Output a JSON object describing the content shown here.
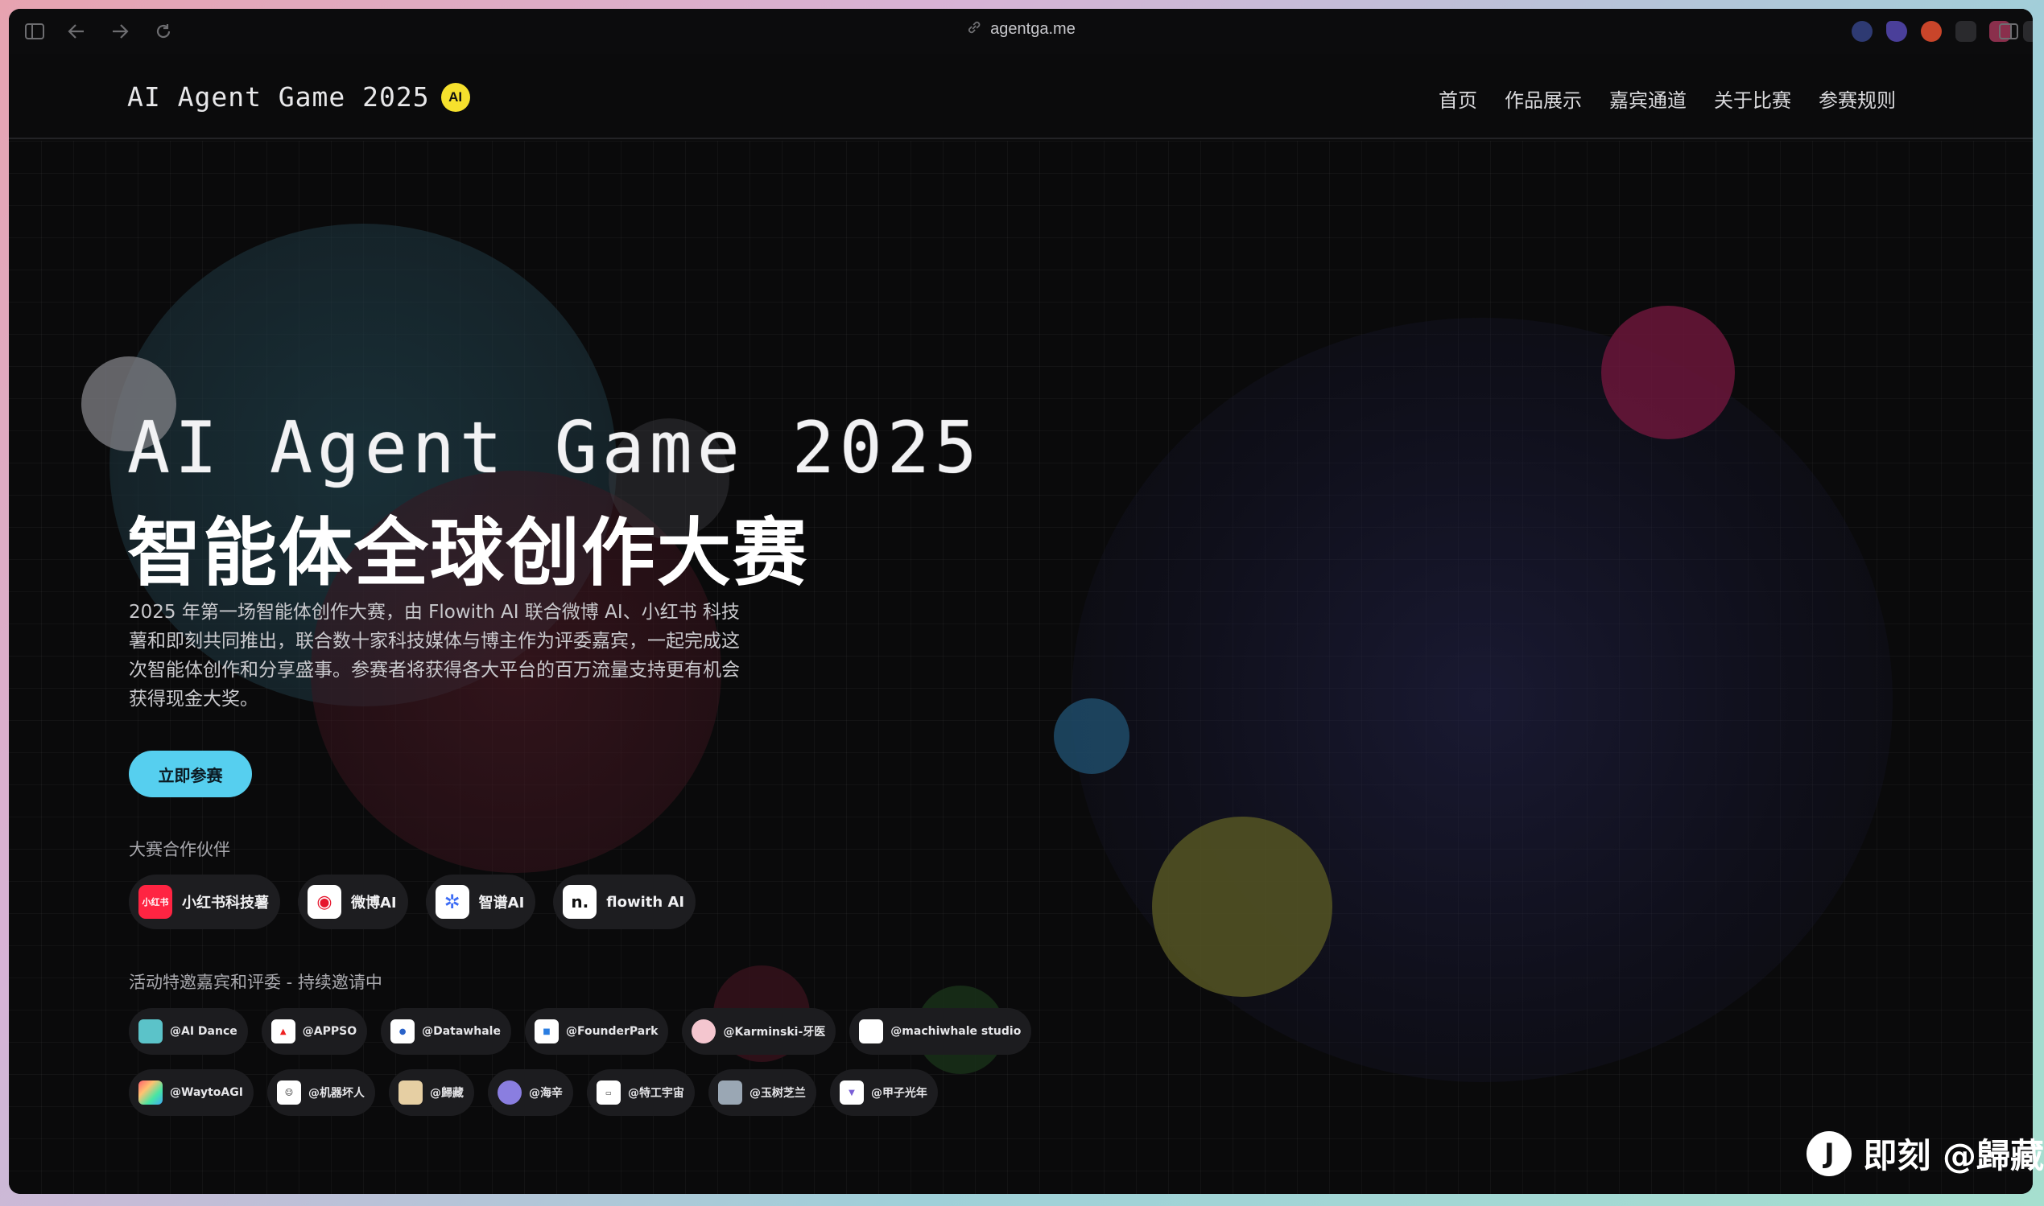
{
  "browser": {
    "url": "agentga.me",
    "icons": [
      "sidebar-icon",
      "back-icon",
      "forward-icon",
      "reload-icon",
      "link-icon"
    ]
  },
  "header": {
    "brand": "AI Agent Game 2025",
    "badge": "AI",
    "nav": [
      "首页",
      "作品展示",
      "嘉宾通道",
      "关于比赛",
      "参赛规则"
    ]
  },
  "hero": {
    "title_en": "AI Agent Game 2025",
    "title_cn": "智能体全球创作大赛",
    "description": "2025 年第一场智能体创作大赛，由 Flowith AI 联合微博 AI、小红书 科技薯和即刻共同推出，联合数十家科技媒体与博主作为评委嘉宾，一起完成这次智能体创作和分享盛事。参赛者将获得各大平台的百万流量支持更有机会获得现金大奖。",
    "cta": "立即参赛"
  },
  "partners": {
    "label": "大赛合作伙伴",
    "items": [
      {
        "name": "小红书科技薯",
        "logo_text": "小红书",
        "color": "#ff2442"
      },
      {
        "name": "微博AI",
        "logo_text": "◉",
        "color": "#ffffff"
      },
      {
        "name": "智谱AI",
        "logo_text": "✲",
        "color": "#ffffff"
      },
      {
        "name": "flowith AI",
        "logo_text": "n.",
        "color": "#ffffff"
      }
    ]
  },
  "guests": {
    "label": "活动特邀嘉宾和评委 - 持续邀请中",
    "row1": [
      {
        "name": "@AI Dance",
        "color": "#5bc3c9"
      },
      {
        "name": "@APPSO",
        "color": "#ffffff"
      },
      {
        "name": "@Datawhale",
        "color": "#ffffff"
      },
      {
        "name": "@FounderPark",
        "color": "#ffffff"
      },
      {
        "name": "@Karminski-牙医",
        "color": "#f4c6cf"
      },
      {
        "name": "@machiwhale studio",
        "color": "#ffffff"
      }
    ],
    "row2": [
      {
        "name": "@WaytoAGI",
        "color": "#ffb347"
      },
      {
        "name": "@机器坏人",
        "color": "#ffffff"
      },
      {
        "name": "@歸藏",
        "color": "#e6cfa3"
      },
      {
        "name": "@海辛",
        "color": "#8a7ee0"
      },
      {
        "name": "@特工宇宙",
        "color": "#ffffff"
      },
      {
        "name": "@玉树芝兰",
        "color": "#9aa7b4"
      },
      {
        "name": "@甲子光年",
        "color": "#ffffff"
      }
    ]
  },
  "watermark": {
    "logo": "J",
    "text": "即刻 @歸藏"
  },
  "colors": {
    "accent": "#56cfef",
    "badge": "#f6e12d",
    "background": "#0a0a0b"
  }
}
